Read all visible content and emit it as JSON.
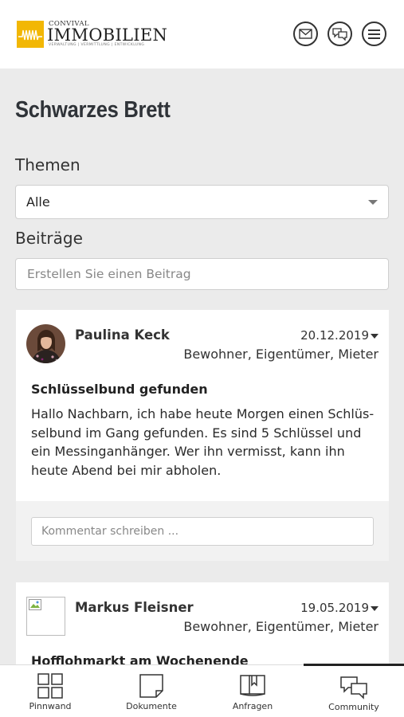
{
  "header": {
    "brand_small": "CONVIVAL",
    "brand_big": "IMMOBILIEN",
    "brand_tagline": "VERWALTUNG | VERMITTLUNG | ENTWICKLUNG",
    "accent": "#f2b705",
    "icons": [
      "mail-icon",
      "chat-icon",
      "menu-icon"
    ]
  },
  "page": {
    "title": "Schwarzes Brett",
    "themen_label": "Themen",
    "themen_selected": "Alle",
    "beitraege_label": "Beiträge",
    "create_placeholder": "Erstellen Sie einen Beitrag"
  },
  "posts": [
    {
      "author": "Paulina Keck",
      "date": "20.12.2019",
      "roles": "Bewohner, Eigentümer, Mieter",
      "title": "Schlüsselbund gefunden",
      "body": "Hallo Nachbarn, ich habe heute Morgen einen Schlüs­selbund im Gang gefunden. Es sind 5 Schlüssel und ein Messinganhänger. Wer ihn vermisst, kann ihn heute Abend bei mir abholen.",
      "comment_placeholder": "Kommentar schreiben ..."
    },
    {
      "author": "Markus Fleisner",
      "date": "19.05.2019",
      "roles": "Bewohner, Eigentümer, Mieter",
      "title": "Hofflohmarkt am Wochenende"
    }
  ],
  "nav": [
    {
      "label": "Pinnwand",
      "icon": "grid-icon"
    },
    {
      "label": "Dokumente",
      "icon": "document-icon"
    },
    {
      "label": "Anfragen",
      "icon": "folder-icon"
    },
    {
      "label": "Community",
      "icon": "chat-bubbles-icon",
      "active": true
    }
  ]
}
